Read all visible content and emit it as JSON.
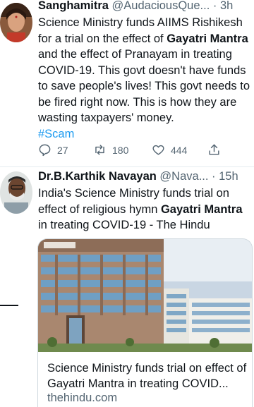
{
  "tweet1": {
    "display_name": "Sanghamitra",
    "handle": "@AudaciousQue...",
    "time": "· 3h",
    "text": {
      "p1": "Science Ministry funds AIIMS Rishikesh for a trial on the effect of ",
      "b1": "Gayatri Mantra",
      "p2": " and the effect of Pranayam in treating COVID-19. This govt doesn't have funds to save people's lives! This govt needs to be fired right now. This is how they are wasting taxpayers' money.",
      "hashtag": "#Scam"
    },
    "actions": {
      "reply_count": "27",
      "retweet_count": "180",
      "like_count": "444"
    }
  },
  "tweet2": {
    "display_name": "Dr.B.Karthik Navayan",
    "handle": "@Nava...",
    "time": "· 15h",
    "text": {
      "p1": "India's Science Ministry funds trial on effect of religious hymn ",
      "b1": "Gayatri Mantra",
      "p2": " in treating COVID-19 - The Hindu"
    },
    "card": {
      "title": "Science Ministry funds trial on effect of Gayatri Mantra in treating COVID...",
      "domain": "thehindu.com"
    }
  },
  "colors": {
    "accent": "#1d9bf0",
    "secondary_text": "#536471",
    "divider": "#e6ecf0"
  },
  "icons": [
    "reply-icon",
    "retweet-icon",
    "like-icon",
    "share-icon"
  ]
}
